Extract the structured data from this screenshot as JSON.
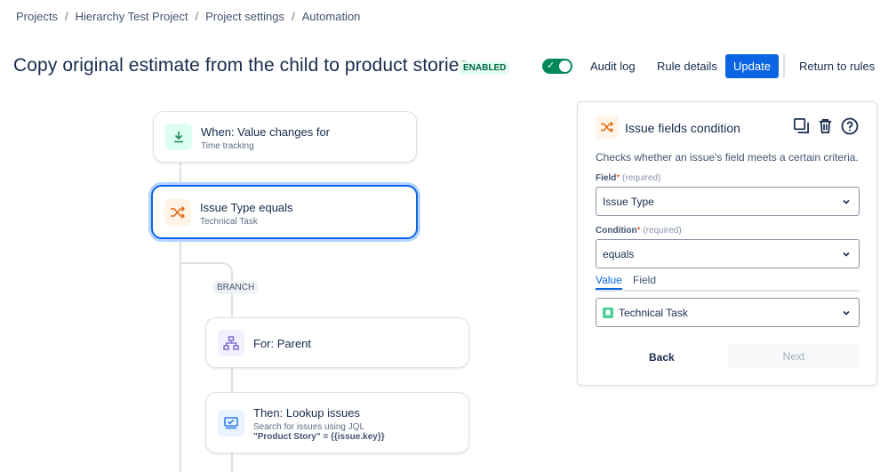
{
  "breadcrumb": {
    "items": [
      "Projects",
      "Hierarchy Test Project",
      "Project settings",
      "Automation"
    ],
    "sep": "/"
  },
  "header": {
    "title": "Copy original estimate from the child to product stories",
    "status": "ENABLED",
    "toggle_on": true,
    "audit_log": "Audit log",
    "rule_details": "Rule details",
    "update": "Update",
    "return": "Return to rules"
  },
  "flow": {
    "trigger": {
      "title": "When: Value changes for",
      "subtitle": "Time tracking",
      "icon": "download-arrow-icon"
    },
    "condition": {
      "title": "Issue Type equals",
      "subtitle": "Technical Task",
      "icon": "shuffle-icon"
    },
    "branch_label": "BRANCH",
    "branch": {
      "title": "For: Parent",
      "icon": "hierarchy-icon"
    },
    "action": {
      "title": "Then: Lookup issues",
      "subtitle": "Search for issues using JQL",
      "jql": "\"Product Story\" = {{issue.key}}",
      "icon": "lookup-icon"
    }
  },
  "panel": {
    "title": "Issue fields condition",
    "description": "Checks whether an issue's field meets a certain criteria.",
    "field_label": "Field",
    "condition_label": "Condition",
    "required_mark": "*",
    "required_text": "(required)",
    "field_value": "Issue Type",
    "condition_value": "equals",
    "tabs": [
      "Value",
      "Field"
    ],
    "value_selected": "Technical Task",
    "back": "Back",
    "next": "Next"
  },
  "colors": {
    "accent": "#0c66e4",
    "enabled_bg": "#e3fcef",
    "enabled_text": "#006644",
    "toggle": "#00875a"
  }
}
